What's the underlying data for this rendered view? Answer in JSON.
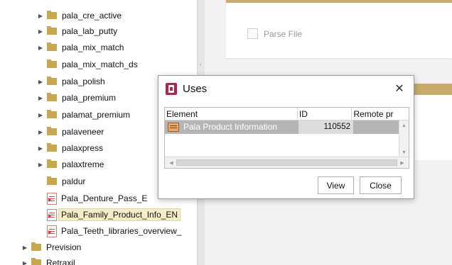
{
  "tree": {
    "items": [
      {
        "label": "pala_cre_active",
        "type": "folder",
        "expandable": true
      },
      {
        "label": "pala_lab_putty",
        "type": "folder",
        "expandable": true
      },
      {
        "label": "pala_mix_match",
        "type": "folder",
        "expandable": true
      },
      {
        "label": "pala_mix_match_ds",
        "type": "folder",
        "expandable": false
      },
      {
        "label": "pala_polish",
        "type": "folder",
        "expandable": true
      },
      {
        "label": "pala_premium",
        "type": "folder",
        "expandable": true
      },
      {
        "label": "palamat_premium",
        "type": "folder",
        "expandable": true
      },
      {
        "label": "palaveneer",
        "type": "folder",
        "expandable": true
      },
      {
        "label": "palaxpress",
        "type": "folder",
        "expandable": true
      },
      {
        "label": "palaxtreme",
        "type": "folder",
        "expandable": true
      },
      {
        "label": "paldur",
        "type": "folder",
        "expandable": false
      },
      {
        "label": "Pala_Denture_Pass_E",
        "type": "file",
        "expandable": false
      },
      {
        "label": "Pala_Family_Product_Info_EN",
        "type": "file",
        "expandable": false,
        "selected": true
      },
      {
        "label": "Pala_Teeth_libraries_overview_",
        "type": "file",
        "expandable": false
      },
      {
        "label": "Prevision",
        "type": "folder",
        "expandable": true
      },
      {
        "label": "Retraxil",
        "type": "folder",
        "expandable": true
      }
    ]
  },
  "content": {
    "parse_file_label": "Parse File"
  },
  "dialog": {
    "title": "Uses",
    "close_symbol": "✕",
    "table": {
      "columns": [
        "Element",
        "ID",
        "Remote pr"
      ],
      "rows": [
        {
          "element": "Pala Product Information",
          "id": "110552",
          "remote": ""
        }
      ]
    },
    "view_label": "View",
    "close_label": "Close"
  },
  "colors": {
    "accent": "#c8ab6a",
    "folder": "#c9a74e",
    "selected_row": "#b5b5b5",
    "dialog_icon": "#b3234a"
  }
}
